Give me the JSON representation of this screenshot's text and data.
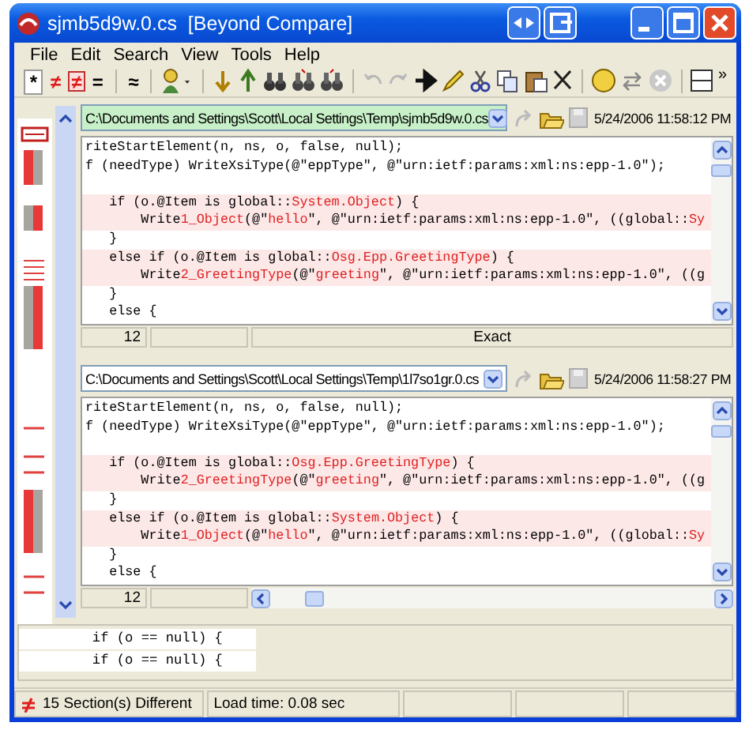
{
  "window": {
    "title": "sjmb5d9w.0.cs  [Beyond Compare]"
  },
  "menu": [
    "File",
    "Edit",
    "Search",
    "View",
    "Tools",
    "Help"
  ],
  "toolbar": [
    {
      "label": "*",
      "selected": true
    },
    {
      "label": "≠",
      "selected": false
    },
    {
      "label": "≠",
      "selected": false,
      "boxed": true
    },
    {
      "label": "=",
      "selected": false
    },
    {
      "label": "≈",
      "selected": false
    }
  ],
  "toolbar_overflow": "»",
  "panes": [
    {
      "path": "C:\\Documents and Settings\\Scott\\Local Settings\\Temp\\sjmb5d9w.0.cs",
      "active": true,
      "timestamp": "5/24/2006 11:58:12 PM",
      "lines": [
        {
          "diff": false,
          "segments": [
            {
              "text": "riteStartElement(n, ns, o, false, null);",
              "changed": false
            }
          ]
        },
        {
          "diff": false,
          "segments": [
            {
              "text": "f (needType) WriteXsiType(@\"eppType\", @\"urn:ietf:params:xml:ns:epp-1.0\");",
              "changed": false
            }
          ]
        },
        {
          "diff": false
        },
        {
          "diff": true,
          "segments": [
            {
              "text": "   if (o.@Item is global::",
              "changed": false
            },
            {
              "text": "System.Object",
              "changed": true
            },
            {
              "text": ") {",
              "changed": false
            }
          ]
        },
        {
          "diff": true,
          "segments": [
            {
              "text": "       Write",
              "changed": false
            },
            {
              "text": "1_Object",
              "changed": true
            },
            {
              "text": "(@\"",
              "changed": false
            },
            {
              "text": "hello",
              "changed": true
            },
            {
              "text": "\", @\"urn:ietf:params:xml:ns:epp-1.0\", ((global::",
              "changed": false
            },
            {
              "text": "Sy",
              "changed": true
            }
          ]
        },
        {
          "diff": false,
          "segments": [
            {
              "text": "   }",
              "changed": false
            }
          ]
        },
        {
          "diff": true,
          "segments": [
            {
              "text": "   else if (o.@Item is global::",
              "changed": false
            },
            {
              "text": "Osg.Epp.GreetingType",
              "changed": true
            },
            {
              "text": ") {",
              "changed": false
            }
          ]
        },
        {
          "diff": true,
          "segments": [
            {
              "text": "       Write",
              "changed": false
            },
            {
              "text": "2_GreetingType",
              "changed": true
            },
            {
              "text": "(@\"",
              "changed": false
            },
            {
              "text": "greeting",
              "changed": true
            },
            {
              "text": "\", @\"urn:ietf:params:xml:ns:epp-1.0\", ((g",
              "changed": false
            }
          ]
        },
        {
          "diff": false,
          "segments": [
            {
              "text": "   }",
              "changed": false
            }
          ]
        },
        {
          "diff": false,
          "segments": [
            {
              "text": "   else {",
              "changed": false
            }
          ]
        }
      ],
      "line_number": "12",
      "status": "Exact"
    },
    {
      "path": "C:\\Documents and Settings\\Scott\\Local Settings\\Temp\\1l7so1gr.0.cs",
      "active": false,
      "timestamp": "5/24/2006 11:58:27 PM",
      "lines": [
        {
          "diff": false,
          "segments": [
            {
              "text": "riteStartElement(n, ns, o, false, null);",
              "changed": false
            }
          ]
        },
        {
          "diff": false,
          "segments": [
            {
              "text": "f (needType) WriteXsiType(@\"eppType\", @\"urn:ietf:params:xml:ns:epp-1.0\");",
              "changed": false
            }
          ]
        },
        {
          "diff": false
        },
        {
          "diff": true,
          "segments": [
            {
              "text": "   if (o.@Item is global::",
              "changed": false
            },
            {
              "text": "Osg.Epp.GreetingType",
              "changed": true
            },
            {
              "text": ") {",
              "changed": false
            }
          ]
        },
        {
          "diff": true,
          "segments": [
            {
              "text": "       Write",
              "changed": false
            },
            {
              "text": "2_GreetingType",
              "changed": true
            },
            {
              "text": "(@\"",
              "changed": false
            },
            {
              "text": "greeting",
              "changed": true
            },
            {
              "text": "\", @\"urn:ietf:params:xml:ns:epp-1.0\", ((g",
              "changed": false
            }
          ]
        },
        {
          "diff": false,
          "segments": [
            {
              "text": "   }",
              "changed": false
            }
          ]
        },
        {
          "diff": true,
          "segments": [
            {
              "text": "   else if (o.@Item is global::",
              "changed": false
            },
            {
              "text": "System.Object",
              "changed": true
            },
            {
              "text": ") {",
              "changed": false
            }
          ]
        },
        {
          "diff": true,
          "segments": [
            {
              "text": "       Write",
              "changed": false
            },
            {
              "text": "1_Object",
              "changed": true
            },
            {
              "text": "(@\"",
              "changed": false
            },
            {
              "text": "hello",
              "changed": true
            },
            {
              "text": "\", @\"urn:ietf:params:xml:ns:epp-1.0\", ((global::",
              "changed": false
            },
            {
              "text": "Sy",
              "changed": true
            }
          ]
        },
        {
          "diff": false,
          "segments": [
            {
              "text": "   }",
              "changed": false
            }
          ]
        },
        {
          "diff": false,
          "segments": [
            {
              "text": "   else {",
              "changed": false
            }
          ]
        }
      ],
      "line_number": "12"
    }
  ],
  "line_compare": [
    "         if (o == null) {",
    "         if (o == null) {"
  ],
  "status_bar": {
    "sections": "15 Section(s) Different",
    "load_time": "Load time:  0.08 sec"
  }
}
